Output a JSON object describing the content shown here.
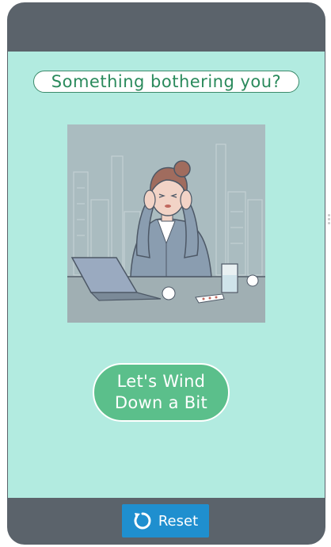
{
  "prompt": {
    "question": "Something bothering you?"
  },
  "illustration": {
    "description_icon": "stressed-woman-illustration-icon"
  },
  "cta": {
    "line1": "Let's Wind",
    "line2": "Down a Bit"
  },
  "footer": {
    "reset_label": "Reset",
    "reset_icon": "refresh-icon"
  },
  "colors": {
    "frame": "#5b636b",
    "screen": "#b2ebe0",
    "accent_green": "#5bbf8b",
    "text_green": "#2a8a5c",
    "reset_blue": "#1f8fcf"
  }
}
